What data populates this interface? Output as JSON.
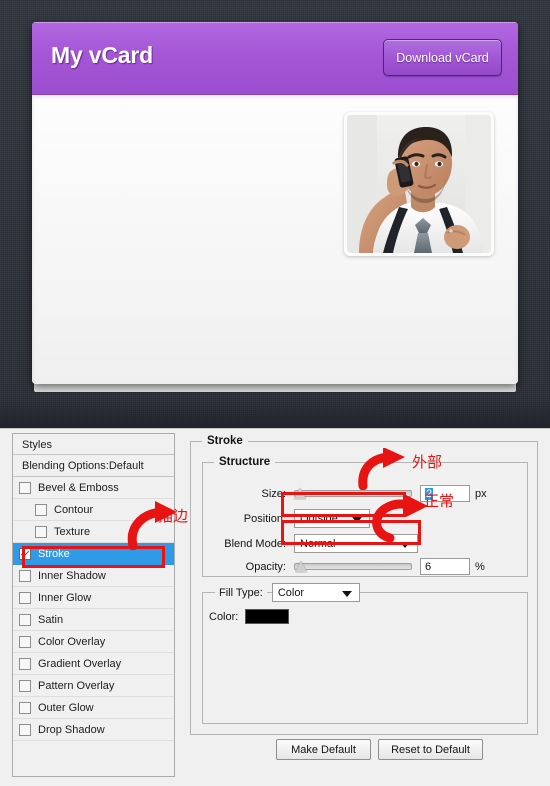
{
  "vcard": {
    "title": "My vCard",
    "download_label": "Download vCard",
    "photo_alt": "portrait-man-on-phone"
  },
  "dialog": {
    "styles_panel": {
      "header": "Styles",
      "blending_options": "Blending Options:Default",
      "items": [
        {
          "label": "Bevel & Emboss",
          "checked": false,
          "indent": false,
          "selected": false
        },
        {
          "label": "Contour",
          "checked": false,
          "indent": true,
          "selected": false
        },
        {
          "label": "Texture",
          "checked": false,
          "indent": true,
          "selected": false
        },
        {
          "label": "Stroke",
          "checked": true,
          "indent": false,
          "selected": true
        },
        {
          "label": "Inner Shadow",
          "checked": false,
          "indent": false,
          "selected": false
        },
        {
          "label": "Inner Glow",
          "checked": false,
          "indent": false,
          "selected": false
        },
        {
          "label": "Satin",
          "checked": false,
          "indent": false,
          "selected": false
        },
        {
          "label": "Color Overlay",
          "checked": false,
          "indent": false,
          "selected": false
        },
        {
          "label": "Gradient Overlay",
          "checked": false,
          "indent": false,
          "selected": false
        },
        {
          "label": "Pattern Overlay",
          "checked": false,
          "indent": false,
          "selected": false
        },
        {
          "label": "Outer Glow",
          "checked": false,
          "indent": false,
          "selected": false
        },
        {
          "label": "Drop Shadow",
          "checked": false,
          "indent": false,
          "selected": false
        }
      ]
    },
    "stroke": {
      "group_title": "Stroke",
      "structure_title": "Structure",
      "size_label": "Size:",
      "size_value": "2",
      "size_unit": "px",
      "size_slider_pct": 4,
      "position_label": "Position:",
      "position_value": "Outside",
      "blend_mode_label": "Blend Mode:",
      "blend_mode_value": "Normal",
      "opacity_label": "Opacity:",
      "opacity_value": "6",
      "opacity_unit": "%",
      "opacity_slider_pct": 5,
      "fill_type_label": "Fill Type:",
      "fill_type_value": "Color",
      "color_label": "Color:",
      "color_value": "#000000"
    },
    "buttons": {
      "make_default": "Make Default",
      "reset_to_default": "Reset to Default"
    }
  },
  "annotations": {
    "stroke_cn": "描边",
    "outside_cn": "外部",
    "normal_cn": "正常",
    "color": "#e81414"
  }
}
